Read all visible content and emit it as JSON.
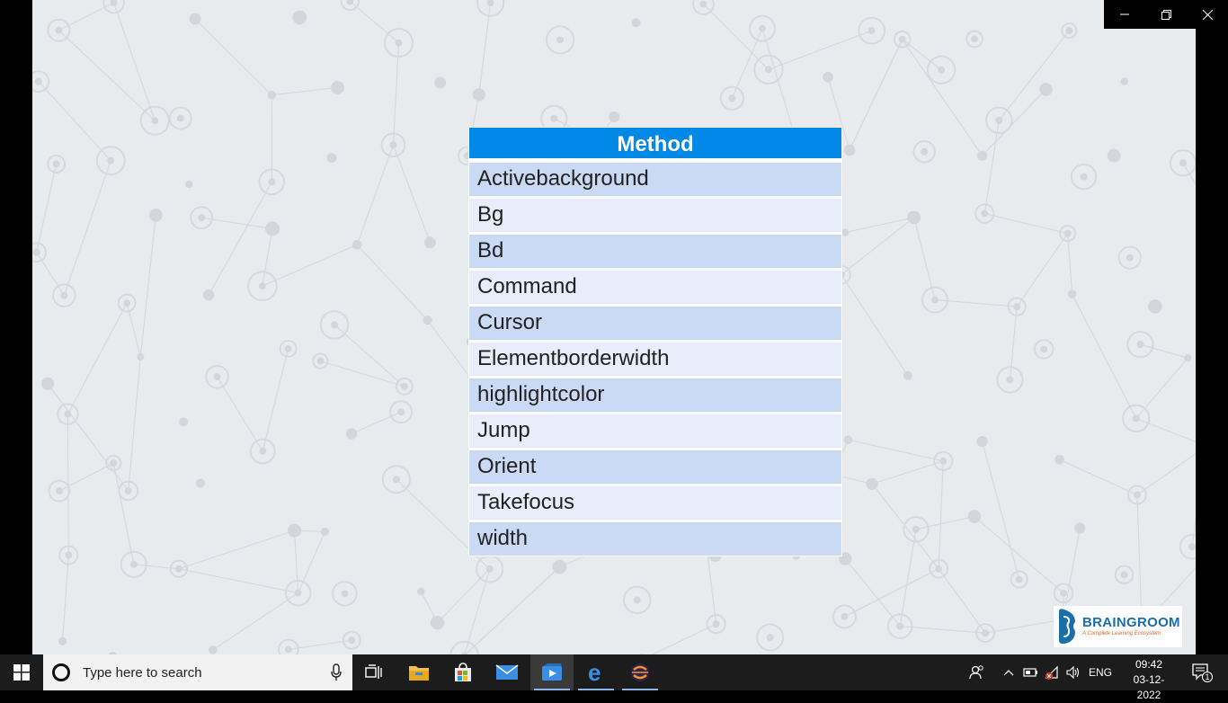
{
  "table": {
    "header": "Method",
    "rows": [
      "Activebackground",
      "Bg",
      "Bd",
      "Command",
      "Cursor",
      "Elementborderwidth",
      "highlightcolor",
      "Jump",
      "Orient",
      "Takefocus",
      "width"
    ]
  },
  "logo": {
    "name": "BRAINGROOM",
    "tagline": "A Complete Learning Ecosystem"
  },
  "taskbar": {
    "search_placeholder": "Type here to search",
    "language": "ENG",
    "time": "09:42",
    "date": "03-12-2022",
    "notification_count": "1",
    "apps": [
      "task-view",
      "file-explorer",
      "microsoft-store",
      "mail",
      "media-player",
      "edge",
      "eclipse"
    ]
  },
  "colors": {
    "header": "#0288e6",
    "row_odd": "#cbdaf4",
    "row_even": "#e8edf9",
    "slide_bg": "#e8ebee"
  }
}
